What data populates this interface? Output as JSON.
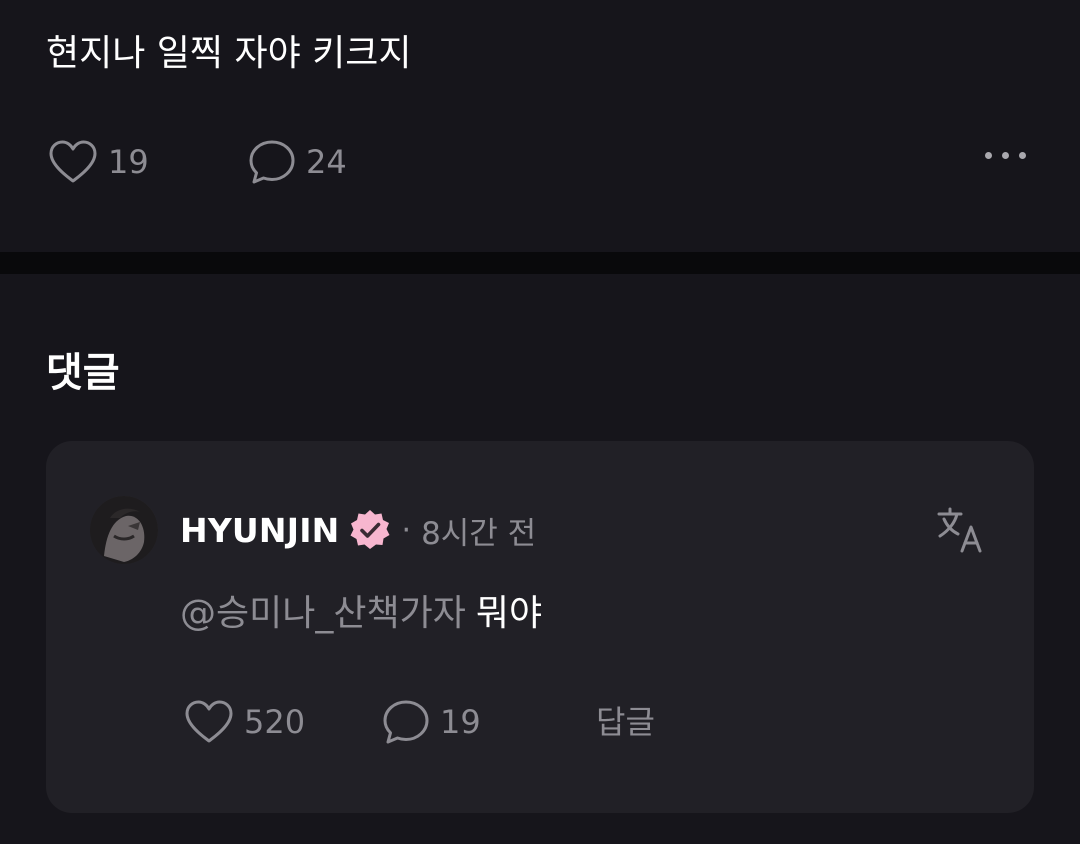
{
  "post": {
    "text": "현지나 일찍 자야 키크지",
    "likes": "19",
    "comments": "24",
    "like_icon": "heart-icon",
    "comment_icon": "chat-bubble-icon",
    "more_icon": "more-horizontal-icon"
  },
  "comments_section": {
    "title": "댓글"
  },
  "comment": {
    "username": "HYUNJIN",
    "verified_badge_icon": "verified-badge-icon",
    "separator": "·",
    "time": "8시간 전",
    "translate_icon": "translate-icon",
    "mention": "@승미나_산책가자",
    "text": "뭐야",
    "likes": "520",
    "replies": "19",
    "reply_label": "답글"
  },
  "colors": {
    "background": "#16151b",
    "card": "#212026",
    "divider": "#09090b",
    "muted_text": "#8d8c93",
    "badge": "#f7b6cf"
  }
}
